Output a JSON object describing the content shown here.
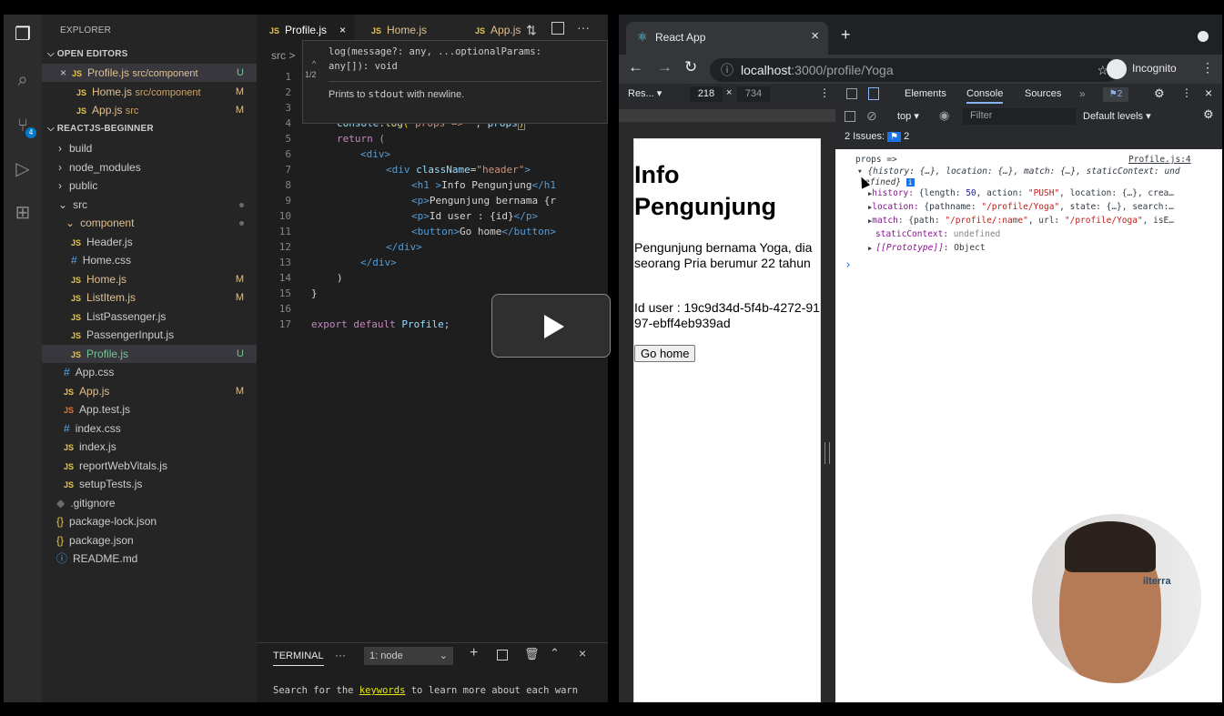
{
  "vscode": {
    "sidebar_title": "EXPLORER",
    "open_editors_label": "OPEN EDITORS",
    "open_editors": [
      {
        "name": "Profile.js",
        "path": "src/component",
        "badge": "U"
      },
      {
        "name": "Home.js",
        "path": "src/component",
        "badge": "M"
      },
      {
        "name": "App.js",
        "path": "src",
        "badge": "M"
      }
    ],
    "project_label": "REACTJS-BEGINNER",
    "tree": {
      "build": "build",
      "node_modules": "node_modules",
      "public": "public",
      "src": "src",
      "component": "component",
      "header_js": "Header.js",
      "home_css": "Home.css",
      "home_js": "Home.js",
      "listitem_js": "ListItem.js",
      "listpassenger_js": "ListPassenger.js",
      "passengerinput_js": "PassengerInput.js",
      "profile_js": "Profile.js",
      "app_css": "App.css",
      "app_js": "App.js",
      "app_test_js": "App.test.js",
      "index_css": "index.css",
      "index_js": "index.js",
      "reportwebvitals_js": "reportWebVitals.js",
      "setuptests_js": "setupTests.js",
      "gitignore": ".gitignore",
      "package_lock": "package-lock.json",
      "package_json": "package.json",
      "readme": "README.md",
      "badge_m": "M",
      "badge_u": "U"
    },
    "tabs": [
      {
        "label": "Profile.js"
      },
      {
        "label": "Home.js"
      },
      {
        "label": "App.js"
      }
    ],
    "breadcrumb": "src >",
    "hover": {
      "signature": "log(message?: any, ...optionalParams:",
      "signature2": "any[]): void",
      "counter": "1/2",
      "description_pre": "Prints to",
      "description_code": "stdout",
      "description_post": "with newline."
    },
    "line_numbers": [
      "1",
      "2",
      "3",
      "4",
      "5",
      "6",
      "7",
      "8",
      "9",
      "10",
      "11",
      "12",
      "13",
      "14",
      "15",
      "16",
      "17"
    ],
    "code": {
      "l4a": "console.",
      "l4b": "log",
      "l4c": "(",
      "l4d": "\"props => \"",
      "l4e": ", props",
      "l4f": ")",
      "l5": "return (",
      "l6": "<div>",
      "l7a": "<div ",
      "l7b": "className",
      "l7c": "=",
      "l7d": "\"header\"",
      "l7e": ">",
      "l8a": "<h1 >",
      "l8b": "Info Pengunjung",
      "l8c": "</h1",
      "l9a": "<p>",
      "l9b": "Pengunjung bernama {r",
      "l10a": "<p>",
      "l10b": "Id user : {id}",
      "l10c": "</p>",
      "l11a": "<button>",
      "l11b": "Go home",
      "l11c": "</button>",
      "l12": "</div>",
      "l13": "</div>",
      "l14": ")",
      "l15": "}",
      "l17a": "export default ",
      "l17b": "Profile;"
    },
    "terminal": {
      "tab": "TERMINAL",
      "more": "···",
      "shell": "1: node",
      "line_pre": "Search for the ",
      "line_link": "keywords",
      "line_post": " to learn more about each warn"
    }
  },
  "chrome": {
    "tab_title": "React App",
    "url_host": "localhost",
    "url_rest": ":3000/profile/Yoga",
    "profile_label": "Incognito",
    "device": {
      "name": "Res...",
      "width": "218",
      "x": "×",
      "height": "734"
    },
    "devtools_tabs": [
      "Elements",
      "Console",
      "Sources",
      "»"
    ],
    "issues_count": "2",
    "console_toolbar": {
      "context": "top ▾",
      "filter_placeholder": "Filter",
      "levels": "Default levels ▾"
    },
    "issues_label": "2 Issues:",
    "page": {
      "heading": "Info Pengunjung",
      "paragraph1": "Pengunjung bernama Yoga, dia seorang Pria berumur 22 tahun",
      "paragraph2": "Id user : 19c9d34d-5f4b-4272-9197-ebff4eb939ad",
      "button": "Go home"
    },
    "console": {
      "source_link": "Profile.js:4",
      "log_label": "props =>",
      "summary": "{history: {…}, location: {…}, match: {…}, staticContext: und",
      "summary2": "efined}",
      "history_key": "history:",
      "history_val_pre": " {length: ",
      "history_len": "50",
      "history_val_mid": ", action: ",
      "history_action": "\"PUSH\"",
      "history_val_post": ", location: {…}, crea…",
      "location_key": "location:",
      "location_pre": " {pathname: ",
      "location_path": "\"/profile/Yoga\"",
      "location_post": ", state: {…}, search:…",
      "match_key": "match:",
      "match_pre": " {path: ",
      "match_path": "\"/profile/:name\"",
      "match_mid": ", url: ",
      "match_url": "\"/profile/Yoga\"",
      "match_post": ", isE…",
      "static_key": "staticContext:",
      "static_val": " undefined",
      "proto_key": "[[Prototype]]",
      "proto_val": ": Object",
      "prompt": "›"
    }
  },
  "webcam": {
    "watermark": "ilterra"
  }
}
